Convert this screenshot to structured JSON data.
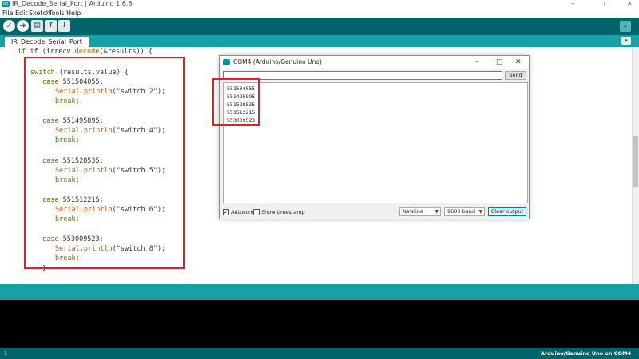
{
  "titlebar": {
    "logo_text": "oo",
    "title": "IR_Decode_Serial_Port | Arduino 1.6.8",
    "minimize": "–",
    "maximize": "□",
    "close": "✕"
  },
  "menu": {
    "file": "File",
    "edit": "Edit",
    "sketch": "Sketch",
    "tools": "Tools",
    "help": "Help"
  },
  "toolbar": {
    "verify_icon": "check-icon",
    "upload_icon": "arrow-right-icon",
    "new_icon": "new-file-icon",
    "open_icon": "arrow-up-icon",
    "save_icon": "arrow-down-icon",
    "serial_icon": "magnifier-icon"
  },
  "tabs": {
    "active": "IR_Decode_Serial_Port",
    "menu_glyph": "▾"
  },
  "editor": {
    "line_if_1": "if (irrecv.",
    "line_if_fn": "decode",
    "line_if_2": "(&results)) {",
    "switch_kw": "switch",
    "switch_rest": " (results.value) {",
    "cases": [
      {
        "case_kw": "case",
        "value": " 551504055:",
        "serial": "Serial",
        "println": "println",
        "arg": "(\"switch 2\");",
        "brk": "break;"
      },
      {
        "case_kw": "case",
        "value": " 551495895:",
        "serial": "Serial",
        "println": "println",
        "arg": "(\"switch 4\");",
        "brk": "break;"
      },
      {
        "case_kw": "case",
        "value": " 551528535:",
        "serial": "Serial",
        "println": "println",
        "arg": "(\"switch 5\");",
        "brk": "break;"
      },
      {
        "case_kw": "case",
        "value": " 551512215:",
        "serial": "Serial",
        "println": "println",
        "arg": "(\"switch 6\");",
        "brk": "break;"
      },
      {
        "case_kw": "case",
        "value": " 553009523:",
        "serial": "Serial",
        "println": "println",
        "arg": "(\"switch 8\");",
        "brk": "break;"
      }
    ],
    "closing_brace": "}"
  },
  "serial_monitor": {
    "title": "COM4 (Arduino/Genuino Uno)",
    "input_value": "",
    "send_label": "Send",
    "output_lines": [
      "551504055",
      "551495895",
      "551528535",
      "551512215",
      "553009523"
    ],
    "autoscroll_label": "Autoscroll",
    "autoscroll_checked": "✓",
    "timestamp_label": "Show timestamp",
    "line_ending": "Newline",
    "baud": "9600 baud",
    "clear_label": "Clear output"
  },
  "footer": {
    "line_number": "1",
    "board": "Arduino/Genuino Uno on COM4"
  },
  "colors": {
    "toolbar": "#006468",
    "tabs": "#17a1a5",
    "highlight_box": "#d9232a"
  }
}
